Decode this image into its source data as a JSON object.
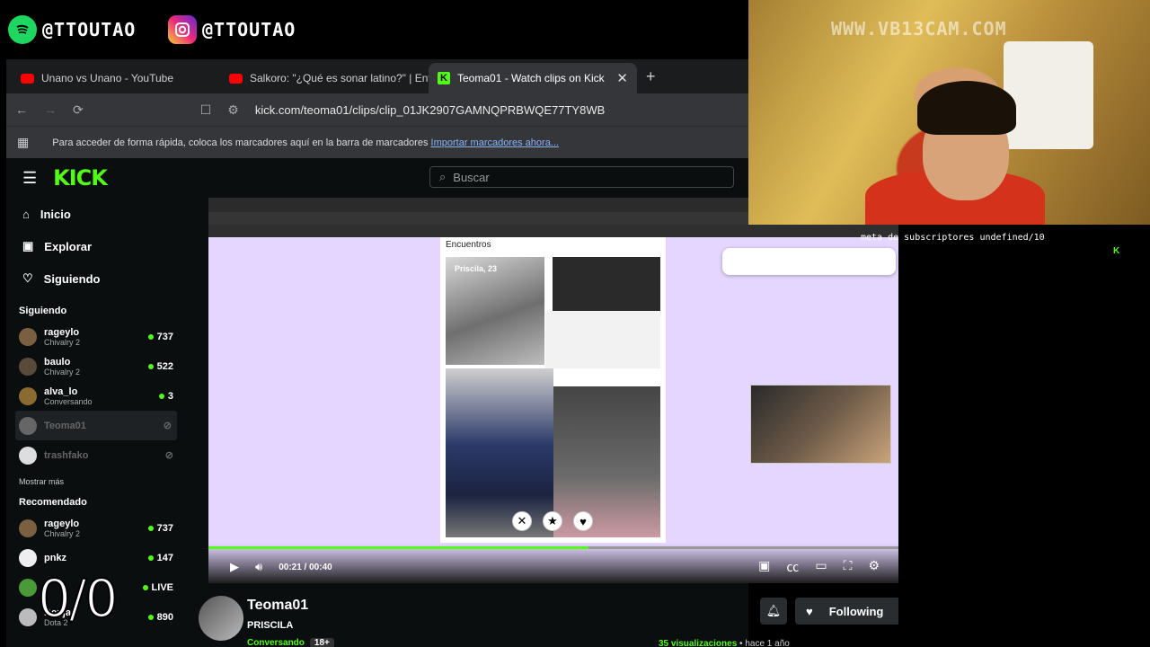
{
  "social": {
    "spotify_handle": "@TTOUTAO",
    "instagram_handle": "@TTOUTAO",
    "spotify_icon": "spotify-icon",
    "instagram_icon": "instagram-icon"
  },
  "browser": {
    "tabs": [
      {
        "label": "Unano vs Unano - YouTube"
      },
      {
        "label": "Salkoro: \"¿Qué es sonar latino?\" | Ent"
      },
      {
        "label": "Teoma01 - Watch clips on Kick"
      }
    ],
    "url": "kick.com/teoma01/clips/clip_01JK2907GAMNQPRBWQE77TY8WB",
    "bookmarks_hint": "Para acceder de forma rápida, coloca los marcadores aquí en la barra de marcadores",
    "bookmarks_link": "Importar marcadores ahora..."
  },
  "kick": {
    "logo": "KICK",
    "search_placeholder": "Buscar",
    "nav": [
      {
        "label": "Inicio"
      },
      {
        "label": "Explorar"
      },
      {
        "label": "Siguiendo"
      }
    ],
    "following_title": "Siguiendo",
    "following": [
      {
        "name": "rageylo",
        "sub": "Chivalry 2",
        "count": "737"
      },
      {
        "name": "baulo",
        "sub": "Chivalry 2",
        "count": "522"
      },
      {
        "name": "alva_lo",
        "sub": "Conversando",
        "count": "3"
      },
      {
        "name": "Teoma01",
        "sub": "",
        "count": ""
      },
      {
        "name": "trashfako",
        "sub": "",
        "count": ""
      }
    ],
    "show_more": "Mostrar más",
    "recommended_title": "Recomendado",
    "recommended": [
      {
        "name": "rageylo",
        "sub": "Chivalry 2",
        "count": "737"
      },
      {
        "name": "pnkz",
        "sub": "",
        "count": "147"
      },
      {
        "name": "",
        "sub": "",
        "count": "LIVE"
      },
      {
        "name": "Benjaz",
        "sub": "Dota 2",
        "count": "890"
      }
    ]
  },
  "player": {
    "inner_title": "Encuentros",
    "profile_label": "Priscila, 23",
    "time_current": "00:21",
    "time_total": "00:40",
    "progress": 0.55
  },
  "clip": {
    "channel": "Teoma01",
    "title": "PRISCILA",
    "category": "Conversando",
    "age": "18+",
    "follow_label": "Following",
    "views": "35 visualizaciones",
    "ago": "hace 1 año"
  },
  "webcam": {
    "watermark": "WWW.VB13CAM.COM",
    "subs_text": "meta de subscriptores undefined/10"
  },
  "overlay": {
    "counter": "0/0"
  },
  "colors": {
    "kick_green": "#53fc18",
    "player_bg": "#e4d6ff"
  }
}
